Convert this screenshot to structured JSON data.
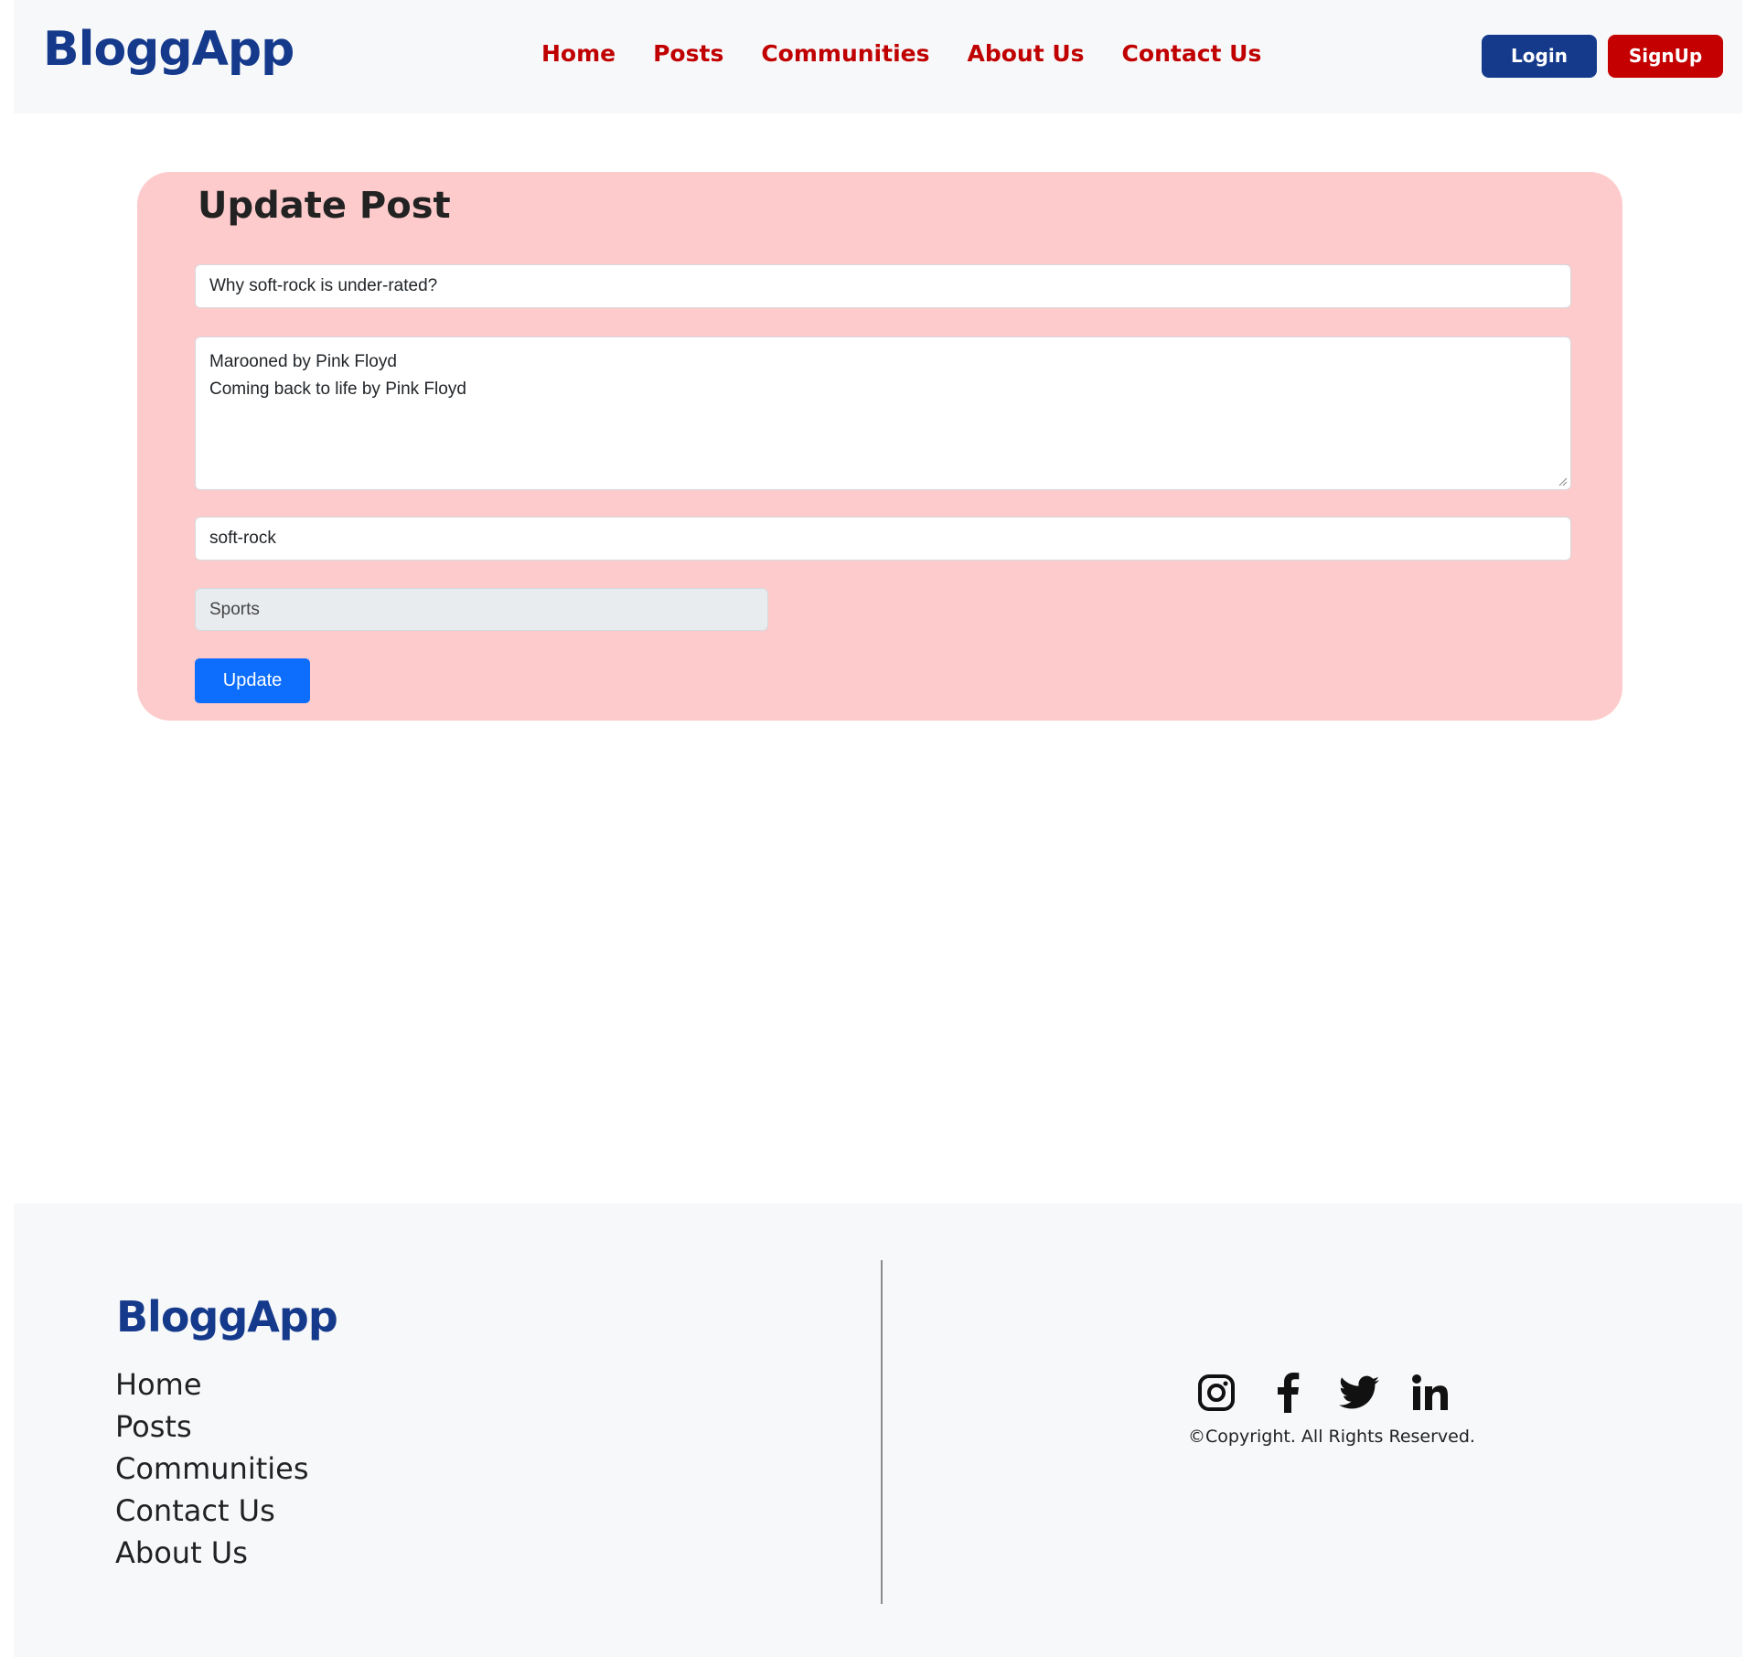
{
  "header": {
    "brand": "BloggApp",
    "nav": [
      "Home",
      "Posts",
      "Communities",
      "About Us",
      "Contact Us"
    ],
    "login_label": "Login",
    "signup_label": "SignUp"
  },
  "form": {
    "title": "Update Post",
    "post_title_value": "Why soft-rock is under-rated?",
    "body_lines": [
      "Marooned by Pink Floyd",
      "Coming back to life by Pink Floyd"
    ],
    "tag_value": "soft-rock",
    "community_value": "Sports",
    "submit_label": "Update"
  },
  "footer": {
    "brand": "BloggApp",
    "links": [
      "Home",
      "Posts",
      "Communities",
      "Contact Us",
      "About Us"
    ],
    "socials": [
      "instagram-icon",
      "facebook-icon",
      "twitter-icon",
      "linkedin-icon"
    ],
    "copyright": "©Copyright. All Rights Reserved."
  },
  "colors": {
    "brand_blue": "#153a8c",
    "accent_red": "#c00000",
    "card_pink": "#fdcbcb",
    "primary_button": "#0d6efd"
  }
}
